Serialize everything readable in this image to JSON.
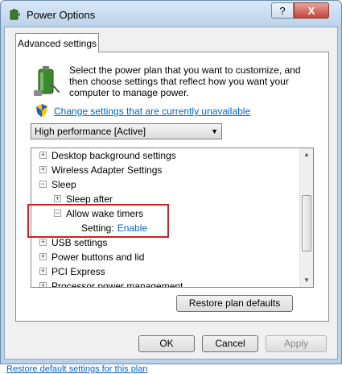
{
  "window": {
    "title": "Power Options",
    "help_label": "?",
    "close_label": "X"
  },
  "tab": {
    "label": "Advanced settings"
  },
  "description": "Select the power plan that you want to customize, and then choose settings that reflect how you want your computer to manage power.",
  "change_settings_link": "Change settings that are currently unavailable",
  "plan_select": {
    "value": "High performance [Active]"
  },
  "tree": {
    "items": [
      {
        "label": "Desktop background settings",
        "expander": "+"
      },
      {
        "label": "Wireless Adapter Settings",
        "expander": "+"
      },
      {
        "label": "Sleep",
        "expander": "−"
      },
      {
        "label": "Sleep after",
        "expander": "+"
      },
      {
        "label": "Allow wake timers",
        "expander": "−"
      },
      {
        "label": "Setting:",
        "value": "Enable"
      },
      {
        "label": "USB settings",
        "expander": "+"
      },
      {
        "label": "Power buttons and lid",
        "expander": "+"
      },
      {
        "label": "PCI Express",
        "expander": "+"
      },
      {
        "label": "Processor power management",
        "expander": "+"
      }
    ]
  },
  "buttons": {
    "restore_defaults": "Restore plan defaults",
    "ok": "OK",
    "cancel": "Cancel",
    "apply": "Apply"
  },
  "bottom_link": "Restore default settings for this plan",
  "colors": {
    "link": "#0066cc",
    "highlight": "#cc2020",
    "titlebar": "#bcd3ea"
  }
}
